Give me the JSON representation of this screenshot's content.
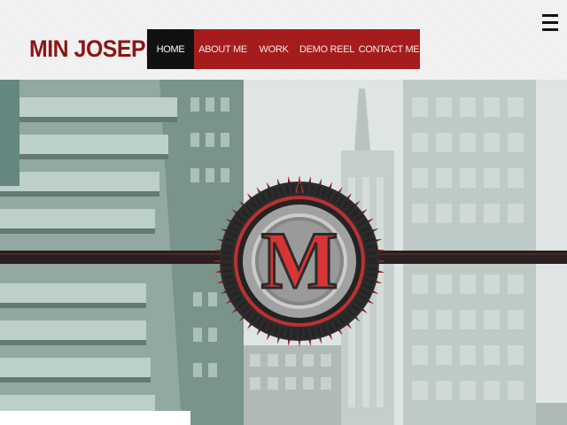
{
  "site": {
    "brand": "MIN JOSEPH"
  },
  "nav": {
    "items": [
      {
        "label": "HOME",
        "active": true
      },
      {
        "label": "ABOUT ME",
        "active": false
      },
      {
        "label": "WORK",
        "active": false
      },
      {
        "label": "DEMO REEL",
        "active": false
      },
      {
        "label": "CONTACT ME",
        "active": false
      }
    ]
  },
  "hero": {
    "logo_letter": "M"
  },
  "colors": {
    "brand_red": "#8e1414",
    "nav_red": "#a51c1c",
    "nav_active": "#111111",
    "band": "#1a0c0c"
  },
  "icons": {
    "menu": "hamburger-menu-icon"
  }
}
